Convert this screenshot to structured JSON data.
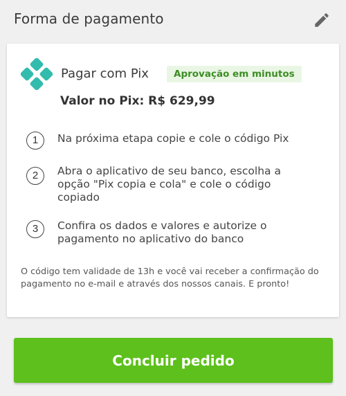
{
  "header": {
    "title": "Forma de pagamento",
    "edit_icon": "pencil-icon"
  },
  "payment": {
    "logo_icon": "pix-logo-icon",
    "method_label": "Pagar com Pix",
    "badge": "Aprovação em minutos",
    "value_text": "Valor no Pix: R$ 629,99"
  },
  "steps": [
    {
      "number": "1",
      "text": "Na próxima etapa copie e cole o código Pix"
    },
    {
      "number": "2",
      "text": "Abra o aplicativo de seu banco, escolha a opção \"Pix copia e cola\" e cole o código copiado"
    },
    {
      "number": "3",
      "text": "Confira os dados e valores e autorize o pagamento no aplicativo do banco"
    }
  ],
  "note": "O código tem validade de 13h e você vai receber a confirmação do pagamento no e-mail e através dos nossos canais. E pronto!",
  "actions": {
    "confirm_label": "Concluir pedido"
  },
  "colors": {
    "pix_teal": "#32bcad",
    "badge_bg": "#e9f6e4",
    "badge_text": "#3d8d25",
    "button_green": "#5dc01c"
  }
}
